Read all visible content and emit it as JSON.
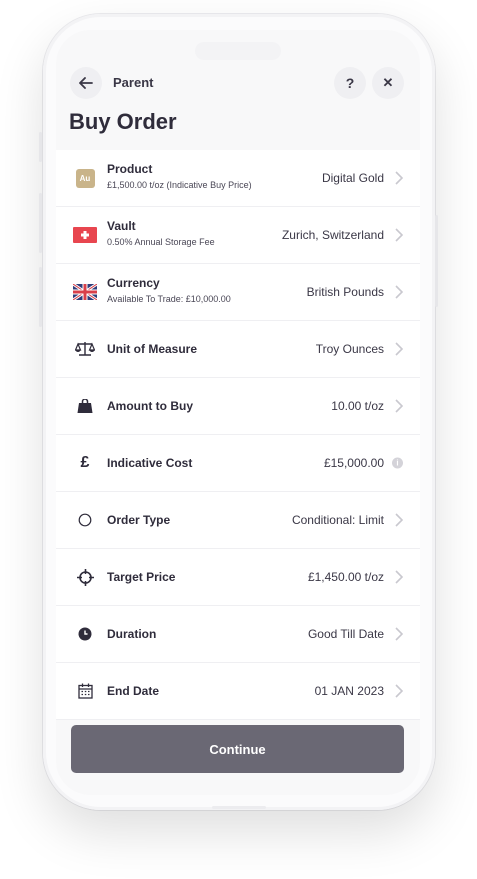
{
  "header": {
    "back_label": "Parent",
    "title": "Buy Order",
    "help_label": "?",
    "close_label": "✕"
  },
  "rows": [
    {
      "title": "Product",
      "subtitle": "£1,500.00 t/oz (Indicative Buy Price)",
      "value": "Digital Gold",
      "icon": "gold-badge-icon",
      "icon_text": "Au"
    },
    {
      "title": "Vault",
      "subtitle": "0.50% Annual Storage Fee",
      "value": "Zurich, Switzerland",
      "icon": "swiss-flag-icon"
    },
    {
      "title": "Currency",
      "subtitle": "Available To Trade: £10,000.00",
      "value": "British Pounds",
      "icon": "uk-flag-icon"
    },
    {
      "title": "Unit of Measure",
      "value": "Troy Ounces",
      "icon": "scales-icon"
    },
    {
      "title": "Amount to Buy",
      "value": "10.00 t/oz",
      "icon": "bag-icon"
    },
    {
      "title": "Indicative Cost",
      "value": "£15,000.00",
      "icon": "pound-icon",
      "icon_text": "£",
      "info": "i"
    },
    {
      "title": "Order Type",
      "value": "Conditional: Limit",
      "icon": "circle-icon"
    },
    {
      "title": "Target Price",
      "value": "£1,450.00 t/oz",
      "icon": "crosshair-icon"
    },
    {
      "title": "Duration",
      "value": "Good Till Date",
      "icon": "clock-icon"
    },
    {
      "title": "End Date",
      "value": "01 JAN 2023",
      "icon": "calendar-icon"
    }
  ],
  "footer": {
    "continue_label": "Continue"
  },
  "colors": {
    "button": "#6a6874",
    "gold_badge": "#c9b48a",
    "swiss_red": "#e8464f",
    "text": "#2f2c3b"
  }
}
